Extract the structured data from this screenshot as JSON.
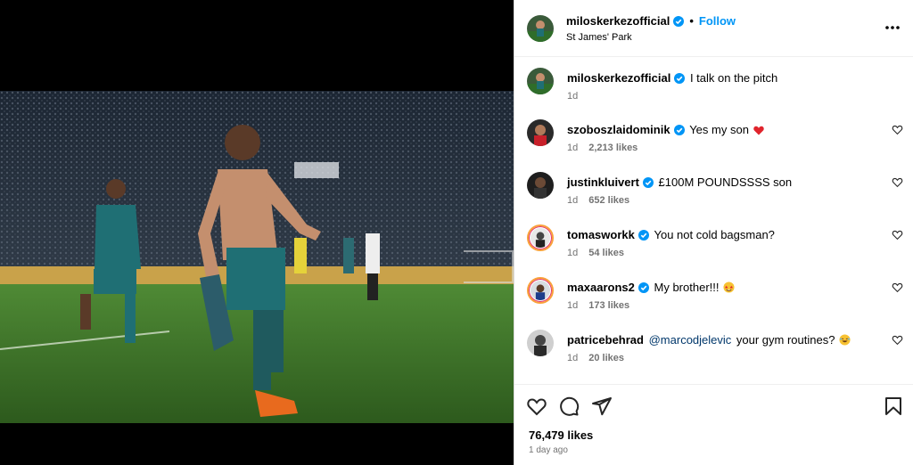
{
  "post": {
    "author": "miloskerkezofficial",
    "follow_label": "Follow",
    "location": "St James' Park",
    "caption": "I talk on the pitch",
    "caption_time": "1d",
    "likes_total": "76,479 likes",
    "time_ago": "1 day ago"
  },
  "comments": [
    {
      "user": "szoboszlaidominik",
      "verified": true,
      "text": "Yes my son",
      "emoji": "red-heart",
      "time": "1d",
      "likes": "2,213 likes"
    },
    {
      "user": "justinkluivert",
      "verified": true,
      "text": "£100M POUNDSSSS son",
      "time": "1d",
      "likes": "652 likes"
    },
    {
      "user": "tomasworkk",
      "verified": true,
      "text": "You not cold bagsman?",
      "time": "1d",
      "likes": "54 likes"
    },
    {
      "user": "maxaarons2",
      "verified": true,
      "text": "My brother!!!",
      "emoji": "star-struck",
      "time": "1d",
      "likes": "173 likes"
    },
    {
      "user": "patricebehrad",
      "verified": false,
      "mention": "@marcodjelevic",
      "text": "your gym routines?",
      "emoji": "laughing",
      "time": "1d",
      "likes": "20 likes"
    }
  ],
  "icons": {
    "more": "more-options-icon",
    "like": "heart-icon",
    "comment": "comment-icon",
    "share": "share-icon",
    "save": "bookmark-icon",
    "verified": "verified-badge-icon"
  },
  "colors": {
    "follow": "#0095f6",
    "verified": "#0095f6",
    "meta": "#737373",
    "heart": "#ed4956"
  }
}
